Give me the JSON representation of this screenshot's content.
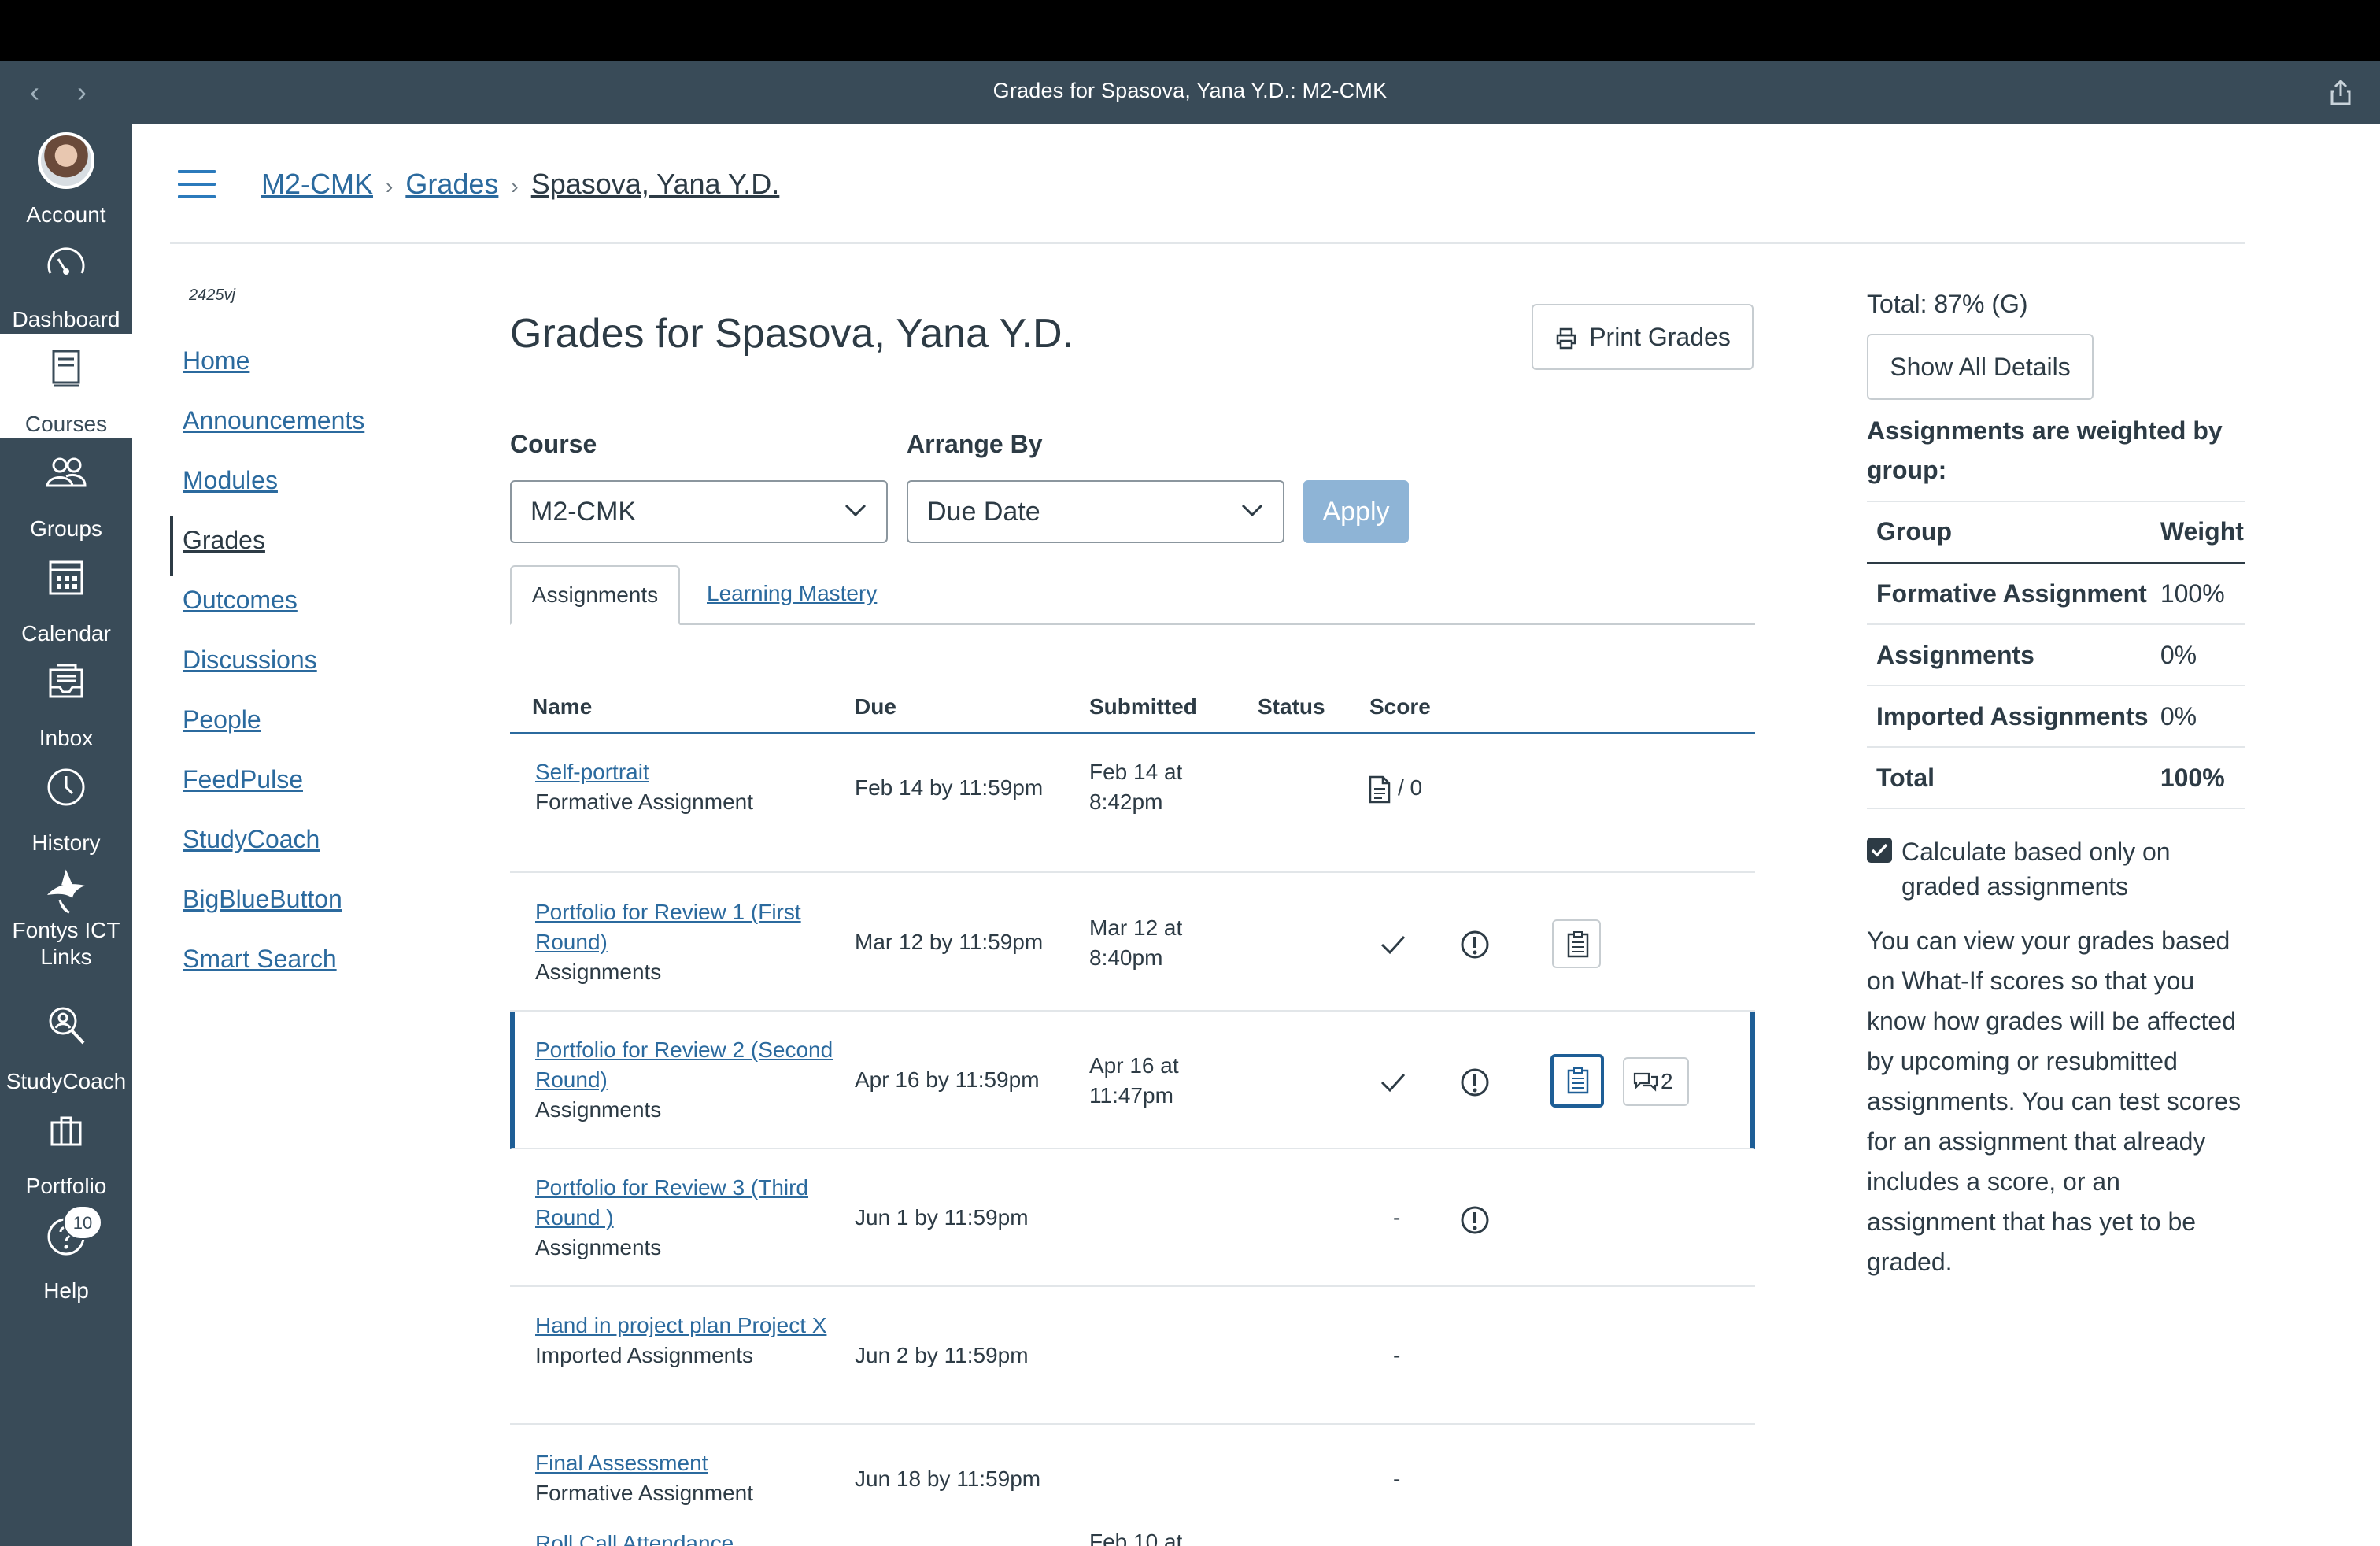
{
  "window": {
    "title": "Grades for Spasova, Yana Y.D.: M2-CMK"
  },
  "global_nav": [
    {
      "label": "Account",
      "icon": "avatar"
    },
    {
      "label": "Dashboard",
      "icon": "dashboard-icon"
    },
    {
      "label": "Courses",
      "icon": "courses-icon",
      "active": true
    },
    {
      "label": "Groups",
      "icon": "groups-icon"
    },
    {
      "label": "Calendar",
      "icon": "calendar-icon"
    },
    {
      "label": "Inbox",
      "icon": "inbox-icon"
    },
    {
      "label": "History",
      "icon": "history-icon"
    },
    {
      "label": "Fontys ICT Links",
      "icon": "shark-icon"
    },
    {
      "label": "StudyCoach",
      "icon": "studycoach-icon"
    },
    {
      "label": "Portfolio",
      "icon": "portfolio-icon"
    },
    {
      "label": "Help",
      "icon": "help-icon",
      "badge": "10"
    }
  ],
  "breadcrumb": {
    "course": "M2-CMK",
    "section": "Grades",
    "student": "Spasova, Yana Y.D."
  },
  "course_nav": {
    "term": "2425vj",
    "items": [
      "Home",
      "Announcements",
      "Modules",
      "Grades",
      "Outcomes",
      "Discussions",
      "People",
      "FeedPulse",
      "StudyCoach",
      "BigBlueButton",
      "Smart Search"
    ],
    "active": "Grades"
  },
  "main": {
    "title": "Grades for Spasova, Yana Y.D.",
    "print_label": "Print Grades",
    "course_label": "Course",
    "course_value": "M2-CMK",
    "arrange_label": "Arrange By",
    "arrange_value": "Due Date",
    "apply_label": "Apply",
    "tabs": [
      "Assignments",
      "Learning Mastery"
    ],
    "columns": [
      "Name",
      "Due",
      "Submitted",
      "Status",
      "Score"
    ],
    "rows": [
      {
        "name": "Self-portrait",
        "group": "Formative Assignment",
        "due": "Feb 14 by 11:59pm",
        "submitted": "Feb 14 at 8:42pm",
        "score": "/ 0"
      },
      {
        "name": "Portfolio for Review 1 (First Round)",
        "group": "Assignments",
        "due": "Mar 12 by 11:59pm",
        "submitted": "Mar 12 at 8:40pm",
        "score": ""
      },
      {
        "name": "Portfolio for Review 2 (Second Round)",
        "group": "Assignments",
        "due": "Apr 16 by 11:59pm",
        "submitted": "Apr 16 at 11:47pm",
        "score": "",
        "comments": "2"
      },
      {
        "name": "Portfolio for Review 3 (Third Round )",
        "group": "Assignments",
        "due": "Jun 1 by 11:59pm",
        "submitted": "",
        "score": "-"
      },
      {
        "name": "Hand in project plan Project X",
        "group": "Imported Assignments",
        "due": "Jun 2 by 11:59pm",
        "submitted": "",
        "score": "-"
      },
      {
        "name": "Final Assessment",
        "group": "Formative Assignment",
        "due": "Jun 18 by 11:59pm",
        "submitted": "",
        "score": "-"
      },
      {
        "name": "Roll Call Attendance",
        "group": "",
        "due": "",
        "submitted": "Feb 10 at",
        "score": ""
      }
    ]
  },
  "sidebar": {
    "total": "Total: 87% (G)",
    "show_details": "Show All Details",
    "weighted_heading": "Assignments are weighted by group:",
    "weight_columns": [
      "Group",
      "Weight"
    ],
    "weights": [
      {
        "group": "Formative Assignment",
        "weight": "100%"
      },
      {
        "group": "Assignments",
        "weight": "0%"
      },
      {
        "group": "Imported Assignments",
        "weight": "0%"
      },
      {
        "group": "Total",
        "weight": "100%"
      }
    ],
    "calc_label": "Calculate based only on graded assignments",
    "calc_checked": true,
    "whatif_text": "You can view your grades based on What-If scores so that you know how grades will be affected by upcoming or resubmitted assignments. You can test scores for an assignment that already includes a score, or an assignment that has yet to be graded."
  }
}
